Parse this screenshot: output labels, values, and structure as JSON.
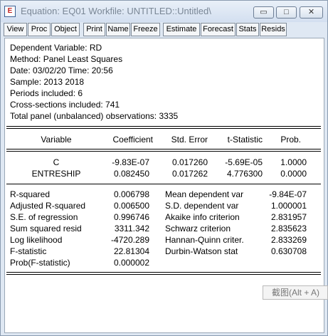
{
  "window": {
    "title": "Equation: EQ01    Workfile: UNTITLED::Untitled\\",
    "controls": {
      "minimize": "▭",
      "maximize": "□",
      "close": "✕"
    }
  },
  "toolbar": {
    "buttons": [
      "View",
      "Proc",
      "Object",
      "Print",
      "Name",
      "Freeze",
      "Estimate",
      "Forecast",
      "Stats",
      "Resids"
    ]
  },
  "output": {
    "header": [
      "Dependent Variable: RD",
      "Method: Panel Least Squares",
      "Date: 03/02/20   Time: 20:56",
      "Sample: 2013 2018",
      "Periods included: 6",
      "Cross-sections included: 741",
      "Total panel (unbalanced) observations: 3335"
    ],
    "coef_table": {
      "columns": [
        "Variable",
        "Coefficient",
        "Std. Error",
        "t-Statistic",
        "Prob."
      ],
      "rows": [
        [
          "C",
          "-9.83E-07",
          "0.017260",
          "-5.69E-05",
          "1.0000"
        ],
        [
          "ENTRESHIP",
          "0.082450",
          "0.017262",
          "4.776300",
          "0.0000"
        ]
      ]
    },
    "stats": {
      "left": [
        [
          "R-squared",
          "0.006798"
        ],
        [
          "Adjusted R-squared",
          "0.006500"
        ],
        [
          "S.E. of regression",
          "0.996746"
        ],
        [
          "Sum squared resid",
          "3311.342"
        ],
        [
          "Log likelihood",
          "-4720.289"
        ],
        [
          "F-statistic",
          "22.81304"
        ],
        [
          "Prob(F-statistic)",
          "0.000002"
        ]
      ],
      "right": [
        [
          "Mean dependent var",
          "-9.84E-07"
        ],
        [
          "S.D. dependent var",
          "1.000001"
        ],
        [
          "Akaike info criterion",
          "2.831957"
        ],
        [
          "Schwarz criterion",
          "2.835623"
        ],
        [
          "Hannan-Quinn criter.",
          "2.833269"
        ],
        [
          "Durbin-Watson stat",
          "0.630708"
        ]
      ]
    }
  },
  "tooltip": {
    "text": "截图(Alt + A)"
  }
}
